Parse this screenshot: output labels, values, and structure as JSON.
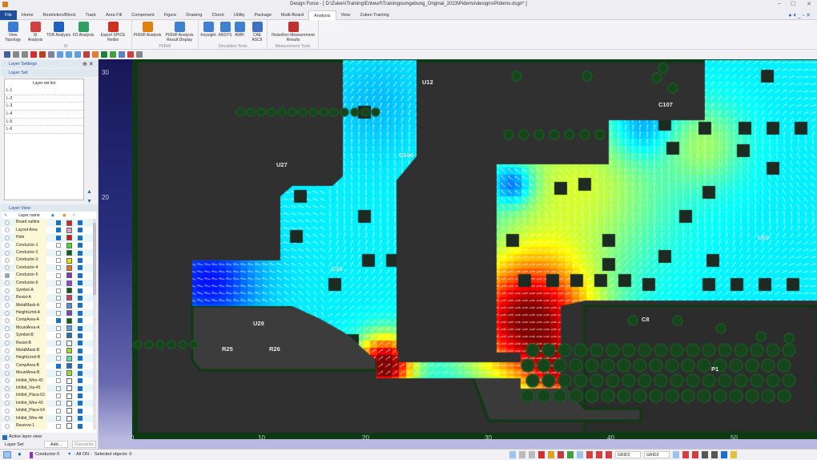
{
  "window": {
    "title": "Design Force - [ D:\\Zuken\\Training\\Entwurf\\Trainingsumgebung_Original_2023\\Pidemo\\designs\\Pidemo.dsgn* ]"
  },
  "menu": {
    "tabs": [
      "File",
      "Home",
      "Restriction/Block",
      "Track",
      "Area Fill",
      "Component",
      "Figure",
      "Drawing",
      "Check",
      "Utility",
      "Package",
      "Multi-Board",
      "Analysis",
      "View",
      "Zuken Training"
    ],
    "active": "Analysis"
  },
  "ribbon": {
    "groups": [
      {
        "label": "SI",
        "buttons": [
          "View Topology",
          "SI Analysis",
          "TDR Analysis",
          "FD Analysis",
          "Export SPICE Netlist"
        ]
      },
      {
        "label": "PI/EMI",
        "buttons": [
          "PI/EMI Analysis",
          "PI/EMI Analysis Result Display"
        ]
      },
      {
        "label": "Simulation Tools",
        "buttons": [
          "Keysight",
          "ANSYS",
          "AWR",
          "CAE ASCII"
        ]
      },
      {
        "label": "Measurement Tools",
        "buttons": [
          "NoiseKen Measurement Results"
        ]
      }
    ]
  },
  "left_panel": {
    "title": "Layer Settings",
    "layer_set": {
      "title": "Layer Set",
      "list_header": "Layer set list",
      "items": [
        "L-1",
        "L-2",
        "L-3",
        "L-4",
        "L-5",
        "L-6"
      ]
    },
    "layer_view": {
      "title": "Layer View",
      "column_header": "Layer name",
      "layers": [
        {
          "name": "Board outline",
          "visible": true,
          "color": "#e02020"
        },
        {
          "name": "Layout Area",
          "visible": true,
          "color": "#e0a0c0"
        },
        {
          "name": "Hole",
          "visible": true,
          "color": "#e01010"
        },
        {
          "name": "Conductor-1",
          "visible": false,
          "color": "#40e020"
        },
        {
          "name": "Conductor-2",
          "visible": false,
          "color": "#106010"
        },
        {
          "name": "Conductor-3",
          "visible": false,
          "color": "#f0e000"
        },
        {
          "name": "Conductor-4",
          "visible": false,
          "color": "#f07010"
        },
        {
          "name": "Conductor-5",
          "visible": false,
          "color": "#9030c0",
          "active": true
        },
        {
          "name": "Conductor-6",
          "visible": false,
          "color": "#a040d0"
        },
        {
          "name": "Symbol-A",
          "visible": false,
          "color": "#106010"
        },
        {
          "name": "Resist-A",
          "visible": false,
          "color": "#d04050"
        },
        {
          "name": "MetalMask-A",
          "visible": false,
          "color": "#5090e0"
        },
        {
          "name": "HeightLimit-A",
          "visible": false,
          "color": "#8040c0"
        },
        {
          "name": "CompArea-A",
          "visible": true,
          "color": "#106010"
        },
        {
          "name": "MountArea-A",
          "visible": false,
          "color": "#60a0e0"
        },
        {
          "name": "Symbol-B",
          "visible": false,
          "color": "#2070c0"
        },
        {
          "name": "Resist-B",
          "visible": false,
          "color": "#ffffff"
        },
        {
          "name": "MetalMask-B",
          "visible": false,
          "color": "#a0e020"
        },
        {
          "name": "HeightLimit-B",
          "visible": false,
          "color": "#60e0a0"
        },
        {
          "name": "CompArea-B",
          "visible": true,
          "color": "#2070c0"
        },
        {
          "name": "MountArea-B",
          "visible": false,
          "color": "#a0e020"
        },
        {
          "name": "Inhibit_Wire-42",
          "visible": false,
          "color": "#ffffff"
        },
        {
          "name": "Inhibit_Via-45",
          "visible": false,
          "color": "#ffffff"
        },
        {
          "name": "Inhibit_Place-63",
          "visible": false,
          "color": "#ffffff"
        },
        {
          "name": "Inhibit_Wire-43",
          "visible": false,
          "color": "#ffffff"
        },
        {
          "name": "Inhibit_Place-64",
          "visible": false,
          "color": "#ffffff"
        },
        {
          "name": "Inhibit_Wire-44",
          "visible": false,
          "color": "#ffffff"
        },
        {
          "name": "Reserve-1",
          "visible": false,
          "color": "#ffffff"
        }
      ]
    },
    "active_layer_view": "Active layer view",
    "layer_set_label": "Layer Set",
    "add_button": "Add...",
    "overwrite_button": "Overwrite"
  },
  "rulers": {
    "vertical": [
      "30",
      "20"
    ],
    "horizontal": [
      "0",
      "10",
      "20",
      "30",
      "40",
      "50"
    ]
  },
  "canvas": {
    "labels": [
      "U12",
      "C107",
      "U27",
      "U29",
      "R25",
      "R26",
      "C8",
      "P1",
      "C104",
      "C10",
      "U10"
    ]
  },
  "status": {
    "layer": "Conductor-5",
    "filter": "- All ON -",
    "selected": "Selected objects: 0",
    "grid1": "GRID3",
    "grid2": "GRID3"
  }
}
